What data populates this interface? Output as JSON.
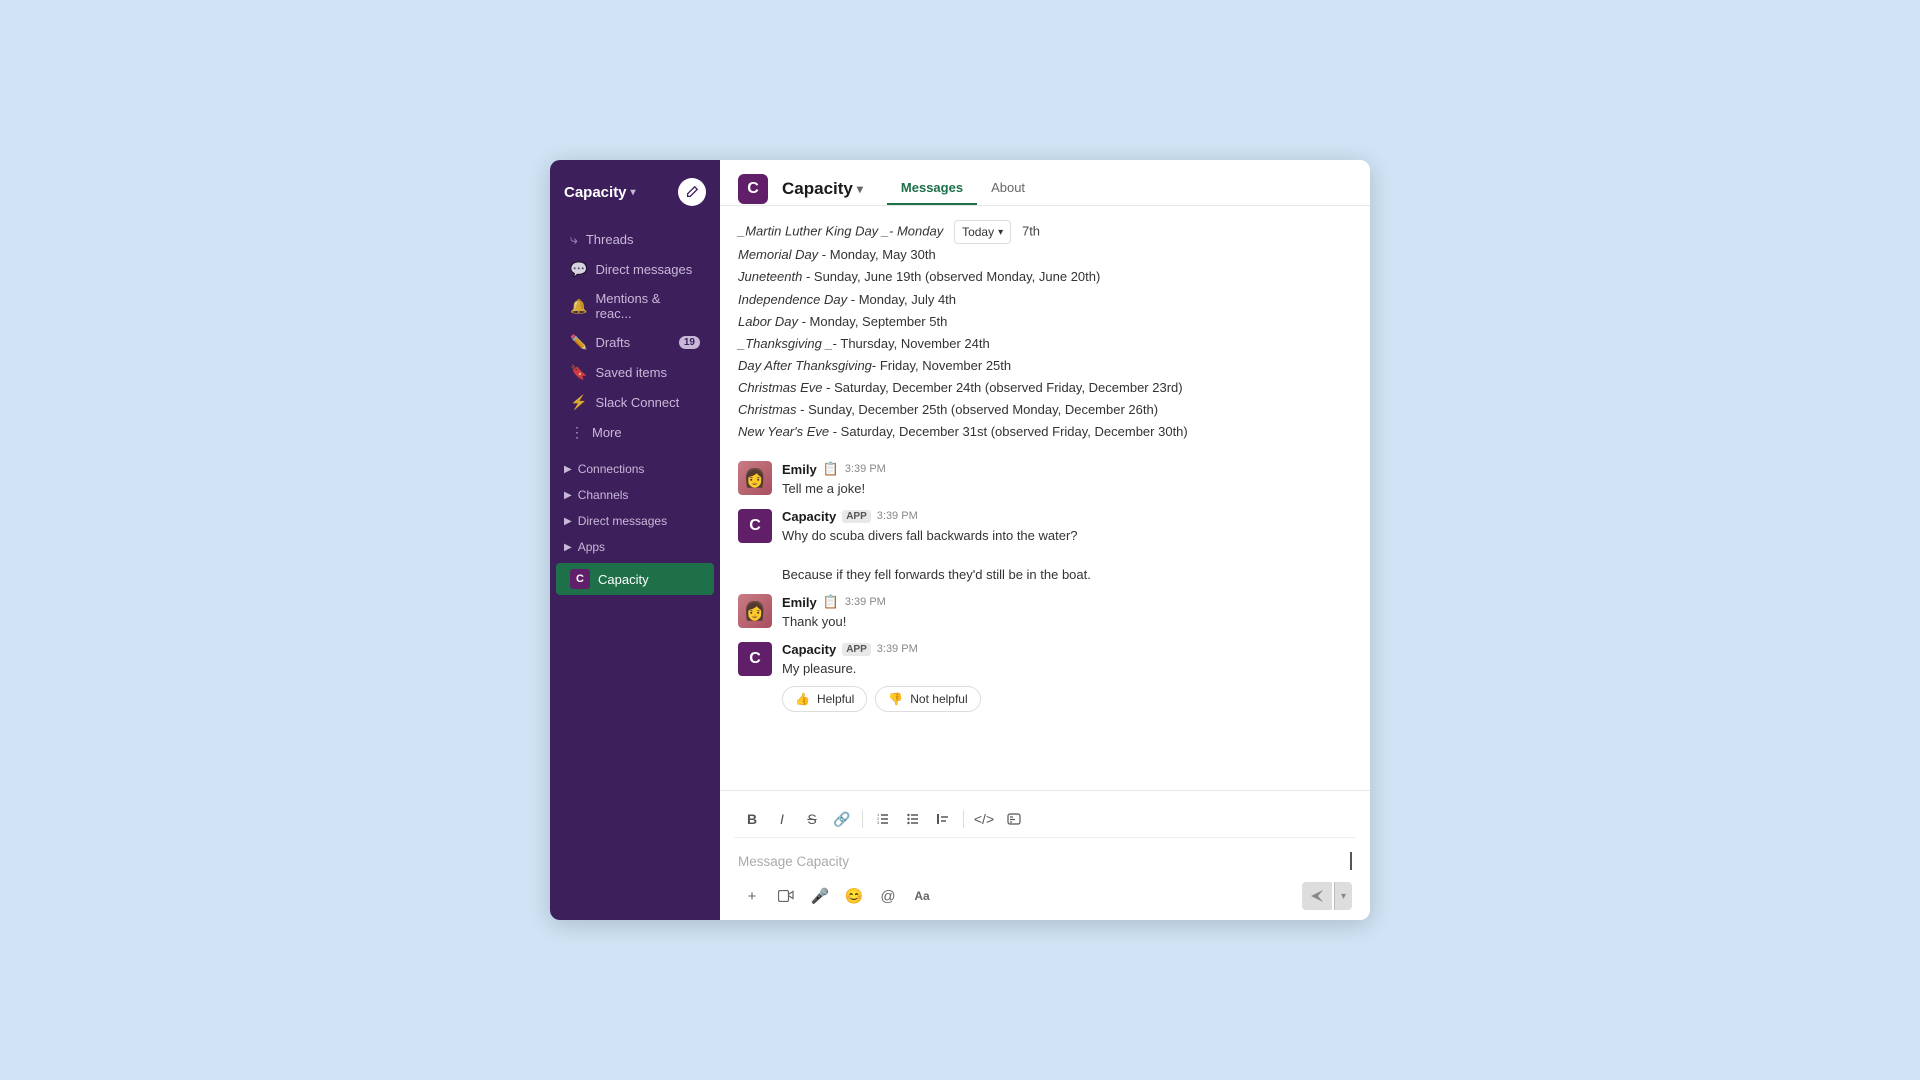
{
  "sidebar": {
    "workspace": "Capacity",
    "nav_items": [
      {
        "id": "threads",
        "label": "Threads",
        "icon": "🔁",
        "badge": null
      },
      {
        "id": "direct-messages",
        "label": "Direct messages",
        "icon": "💬",
        "badge": null
      },
      {
        "id": "mentions",
        "label": "Mentions & reac...",
        "icon": "🔔",
        "badge": null
      },
      {
        "id": "drafts",
        "label": "Drafts",
        "icon": "✏️",
        "badge": "19"
      },
      {
        "id": "saved",
        "label": "Saved items",
        "icon": "🔖",
        "badge": null
      },
      {
        "id": "slack-connect",
        "label": "Slack Connect",
        "icon": "⚡",
        "badge": null
      },
      {
        "id": "more",
        "label": "More",
        "icon": "⋮",
        "badge": null
      }
    ],
    "sections": [
      {
        "id": "connections",
        "label": "Connections"
      },
      {
        "id": "channels",
        "label": "Channels"
      },
      {
        "id": "direct-messages-sec",
        "label": "Direct messages"
      },
      {
        "id": "apps",
        "label": "Apps"
      }
    ],
    "active_channel": "Capacity"
  },
  "channel": {
    "name": "Capacity",
    "logo_letter": "C",
    "tabs": [
      {
        "id": "messages",
        "label": "Messages",
        "active": true
      },
      {
        "id": "about",
        "label": "About",
        "active": false
      }
    ]
  },
  "messages": {
    "holidays_partial": "_Martin Luther King Day _- Monday",
    "today_badge": "Today",
    "day_number": "7th",
    "holiday_lines": [
      {
        "text": "Memorial Day - Monday, May 30th"
      },
      {
        "text": "Juneteenth - Sunday, June 19th (observed Monday, June 20th)"
      },
      {
        "text": "Independence Day - Monday, July 4th"
      },
      {
        "text": "Labor Day - Monday, September 5th"
      },
      {
        "text": "_Thanksgiving _- Thursday, November 24th"
      },
      {
        "text": "Day After Thanksgiving - Friday, November 25th"
      },
      {
        "text": "Christmas Eve - Saturday, December 24th (observed Friday, December 23rd)"
      },
      {
        "text": "Christmas - Sunday, December 25th (observed Monday, December 26th)"
      },
      {
        "text": "New Year's Eve - Saturday, December 31st (observed Friday, December 30th)"
      }
    ],
    "conversation": [
      {
        "id": "emily-1",
        "author": "Emily",
        "author_type": "user",
        "time": "3:39 PM",
        "text": "Tell me a joke!",
        "emoji": "📋"
      },
      {
        "id": "capacity-1",
        "author": "Capacity",
        "author_type": "app",
        "time": "3:39 PM",
        "text_lines": [
          "Why do scuba divers fall backwards into the water?",
          "Because if they fell forwards they'd still be in the boat."
        ]
      },
      {
        "id": "emily-2",
        "author": "Emily",
        "author_type": "user",
        "time": "3:39 PM",
        "text": "Thank you!",
        "emoji": "📋"
      },
      {
        "id": "capacity-2",
        "author": "Capacity",
        "author_type": "app",
        "time": "3:39 PM",
        "text_lines": [
          "My pleasure."
        ],
        "has_feedback": true
      }
    ],
    "feedback": {
      "helpful_label": "👍 Helpful",
      "not_helpful_label": "👎 Not helpful"
    }
  },
  "input": {
    "placeholder": "Message Capacity",
    "toolbar_buttons": [
      "B",
      "I",
      "S",
      "🔗",
      "≡",
      "≡",
      "≡",
      "</>",
      "☐"
    ],
    "bottom_buttons": [
      "+",
      "🖥",
      "🎤",
      "😊",
      "@",
      "Aa"
    ]
  }
}
